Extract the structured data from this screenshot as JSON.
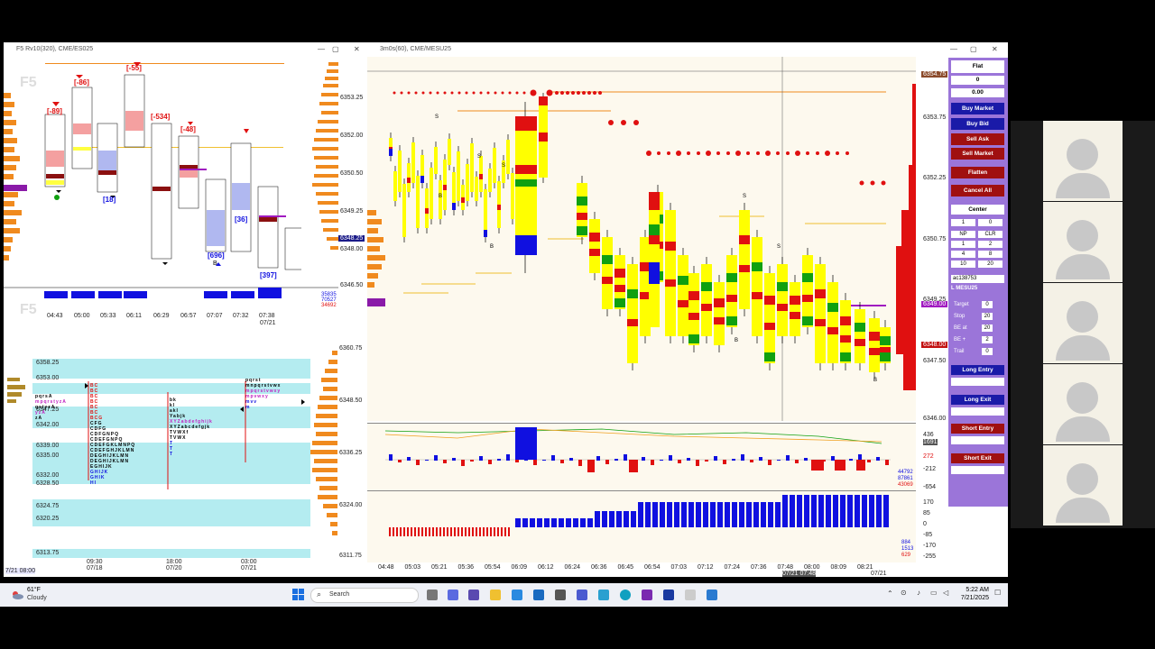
{
  "left_window": {
    "title": "F5 Rv10(320), CME/ES025",
    "watermark_top": "F5",
    "watermark_bottom": "F5",
    "price_ticks": [
      "6353.25",
      "6352.00",
      "6350.50",
      "6349.25",
      "6348.00",
      "6346.50"
    ],
    "current_price": "6348.25",
    "time_labels": [
      "04:43",
      "05:00",
      "05:33",
      "06:11",
      "06:29",
      "06:57",
      "07:07",
      "07:32",
      "07:38"
    ],
    "date_label": "07/21",
    "delta_labels": [
      "[-89]",
      "[-86]",
      "[-55]",
      "[-534]",
      "[-48]",
      "[18]",
      "[696]",
      "[36]",
      "[397]"
    ],
    "volume_readouts": [
      "35835",
      "70527",
      "34692"
    ],
    "small_marks": [
      "361",
      "143",
      "961"
    ],
    "b_marker": "B"
  },
  "profile_window": {
    "price_ticks_left": [
      "6358.25",
      "6353.00",
      "6347.25",
      "6342.00",
      "6339.00",
      "6335.00",
      "6332.00",
      "6328.50",
      "6324.75",
      "6320.25",
      "6313.75"
    ],
    "price_ticks_right": [
      "6360.75",
      "6348.50",
      "6336.25",
      "6324.00",
      "6311.75"
    ],
    "time_labels": [
      {
        "time": "09:30",
        "date": "07/18"
      },
      {
        "time": "18:00",
        "date": "07/20"
      },
      {
        "time": "03:00",
        "date": "07/21"
      }
    ],
    "footer_left": "7/21 08:00",
    "tpo_rows_1": [
      "pqrsA",
      "mpqrstyzA",
      "qstyzA",
      "yzA",
      "zA"
    ],
    "tpo_rows_2": [
      "BC",
      "BC",
      "BC",
      "BC",
      "BC",
      "BC",
      "BCG",
      "CFG",
      "CDFG",
      "CDFGNPQ",
      "CDEFGNPQ",
      "CDEFGKLMNPQ",
      "CDEFGHJKLMN",
      "DEGHIJKLMN",
      "DEGHIJKLMN",
      "EGHIJK",
      "GHIJK",
      "GHIK",
      "HI"
    ],
    "tpo_rows_3": [
      "bk",
      "kl",
      "akl",
      "Yabjk",
      "XYZabdefghijk",
      "XYZabcdefgjk",
      "TVWXf",
      "TVWX",
      "T",
      "T",
      "T"
    ],
    "tpo_rows_4": [
      "pqrst",
      "mnpqrstvwx",
      "mpqrstvwxy",
      "mpvwxy",
      "mvv",
      "m"
    ]
  },
  "main_window": {
    "title": "3m0s(60), CME/MESU25",
    "price_ticks": [
      "6353.75",
      "6352.25",
      "6350.75",
      "6349.25",
      "6347.50",
      "6346.00"
    ],
    "price_tags": [
      {
        "label": "6354.75",
        "color": "#8b4a2a"
      },
      {
        "label": "6349.00",
        "color": "#a01ac0"
      },
      {
        "label": "6348.00",
        "color": "#c21010"
      }
    ],
    "time_labels": [
      "04:48",
      "05:03",
      "05:21",
      "05:36",
      "05:54",
      "06:09",
      "06:12",
      "06:24",
      "06:36",
      "06:45",
      "06:54",
      "07:03",
      "07:12",
      "07:24",
      "07:36",
      "07:48",
      "08:00",
      "08:09",
      "08:21"
    ],
    "crosshair_time": "07/21 07:48",
    "date_label": "07/21",
    "markers": {
      "s": "S",
      "b": "B"
    },
    "subpane1_ticks": [
      "436",
      "1691",
      "272",
      "-212",
      "-654"
    ],
    "subpane1_readouts": [
      "44792",
      "87861",
      "43069"
    ],
    "subpane2_ticks": [
      "170",
      "85",
      "0",
      "-85",
      "-170",
      "-255"
    ],
    "subpane2_readouts": [
      "884",
      "1513",
      "629"
    ]
  },
  "order_panel": {
    "position_label": "Flat",
    "qty": "0",
    "pnl": "0.00",
    "buy_market": "Buy Market",
    "buy_bid": "Buy Bid",
    "sell_ask": "Sell Ask",
    "sell_market": "Sell Market",
    "flatten": "Flatten",
    "cancel_all": "Cancel All",
    "center": "Center",
    "qty_input": "1",
    "qty_right": "0",
    "grid": [
      "NP",
      "CLR",
      "1",
      "2",
      "4",
      "8",
      "10",
      "20"
    ],
    "account": "ac138753",
    "instrument": "L MESU25",
    "fields": [
      {
        "label": "Target",
        "value": "0"
      },
      {
        "label": "Stop",
        "value": "20"
      },
      {
        "label": "BE at",
        "value": "20"
      },
      {
        "label": "BE +",
        "value": "2"
      },
      {
        "label": "Trail",
        "value": "0"
      }
    ],
    "long_entry": "Long Entry",
    "long_exit": "Long Exit",
    "short_entry": "Short Entry",
    "short_exit": "Short Exit"
  },
  "taskbar": {
    "weather_temp": "61°F",
    "weather_desc": "Cloudy",
    "search_placeholder": "Search",
    "time": "5:22 AM",
    "date": "7/21/2025"
  },
  "colors": {
    "up_bar": "#ffff00",
    "down_bar": "#e01010",
    "green": "#10a010",
    "blue": "#1010e0",
    "cream": "#fdf9ee"
  }
}
